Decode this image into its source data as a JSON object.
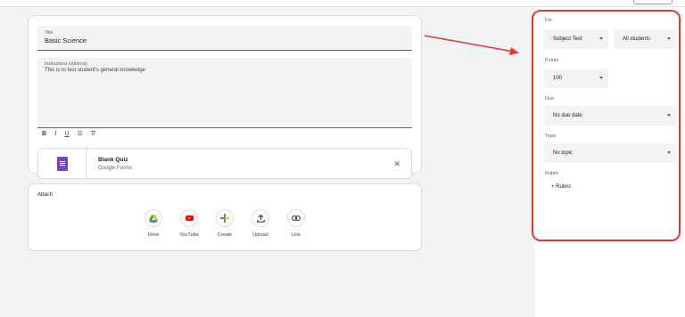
{
  "assignment": {
    "title_label": "Title",
    "title_value": "Basic Science",
    "instructions_label": "Instructions (optional)",
    "instructions_value": "This is to test student's general knowledge"
  },
  "format_toolbar": {
    "bold": "B",
    "italic": "I",
    "underline": "U",
    "list": "☰",
    "clear": "T̸"
  },
  "attachment": {
    "title": "Blank Quiz",
    "subtitle": "Google Forms",
    "icon": "google-forms-icon",
    "remove": "✕"
  },
  "attach": {
    "heading": "Attach",
    "buttons": [
      {
        "label": "Drive",
        "icon": "drive-icon"
      },
      {
        "label": "YouTube",
        "icon": "youtube-icon"
      },
      {
        "label": "Create",
        "icon": "plus-icon"
      },
      {
        "label": "Upload",
        "icon": "upload-icon"
      },
      {
        "label": "Link",
        "icon": "link-icon"
      }
    ]
  },
  "sidebar": {
    "for_label": "For",
    "subject_value": "Subject Test",
    "students_value": "All students",
    "points_label": "Points",
    "points_value": "100",
    "due_label": "Due",
    "due_value": "No due date",
    "topic_label": "Topic",
    "topic_value": "No topic",
    "rubric_label": "Rubric",
    "rubric_button": "+  Rubric"
  },
  "colors": {
    "annotation": "#e53935",
    "forms": "#7248b9",
    "youtube": "#ff0000"
  }
}
